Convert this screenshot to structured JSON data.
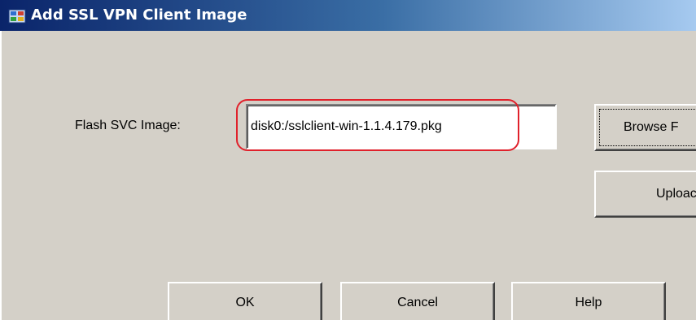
{
  "window": {
    "title": "Add SSL VPN Client Image",
    "icon": "asdm-app-icon"
  },
  "form": {
    "flash_label": "Flash SVC Image:",
    "flash_value": "disk0:/sslclient-win-1.1.4.179.pkg"
  },
  "buttons": {
    "browse_label": "Browse F",
    "upload_label": "Uploac",
    "ok_label": "OK",
    "cancel_label": "Cancel",
    "help_label": "Help"
  },
  "colors": {
    "dialog_bg": "#d4d0c8",
    "titlebar_start": "#0a246a",
    "titlebar_end": "#a6caf0",
    "highlight_ring": "#e0212b"
  }
}
